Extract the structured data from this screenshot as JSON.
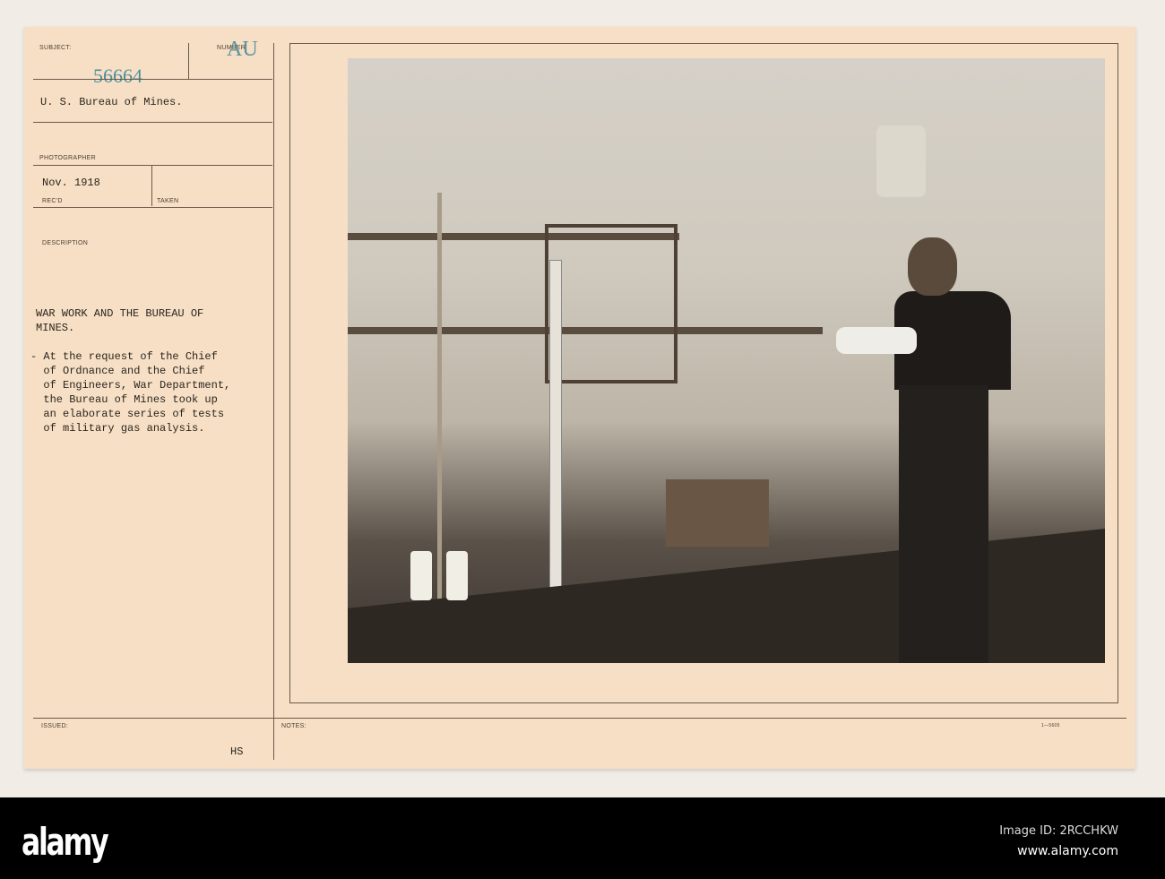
{
  "card": {
    "subject_label": "SUBJECT:",
    "subject_number": "56664",
    "number_label": "NUMBER",
    "number_stamp": "AU",
    "agency": "U. S. Bureau of Mines.",
    "photographer_label": "PHOTOGRAPHER",
    "received_date": "Nov. 1918",
    "received_label": "REC'D",
    "taken_label": "TAKEN",
    "description_label": "DESCRIPTION",
    "title": "WAR WORK AND THE BUREAU OF\nMINES.",
    "description": "- At the request of the Chief\n  of Ordnance and the Chief\n  of Engineers, War Department,\n  the Bureau of Mines took up\n  an elaborate series of tests\n  of military gas analysis.",
    "issued_label": "ISSUED:",
    "issued_initials": "HS",
    "notes_label": "NOTES:",
    "form_number": "1—5605"
  },
  "photo": {
    "subject": "Man in vest performing gas analysis at laboratory bench with glass apparatus"
  },
  "watermark": {
    "logo": "alamy",
    "image_id": "Image ID: 2RCCHKW",
    "url": "www.alamy.com"
  }
}
